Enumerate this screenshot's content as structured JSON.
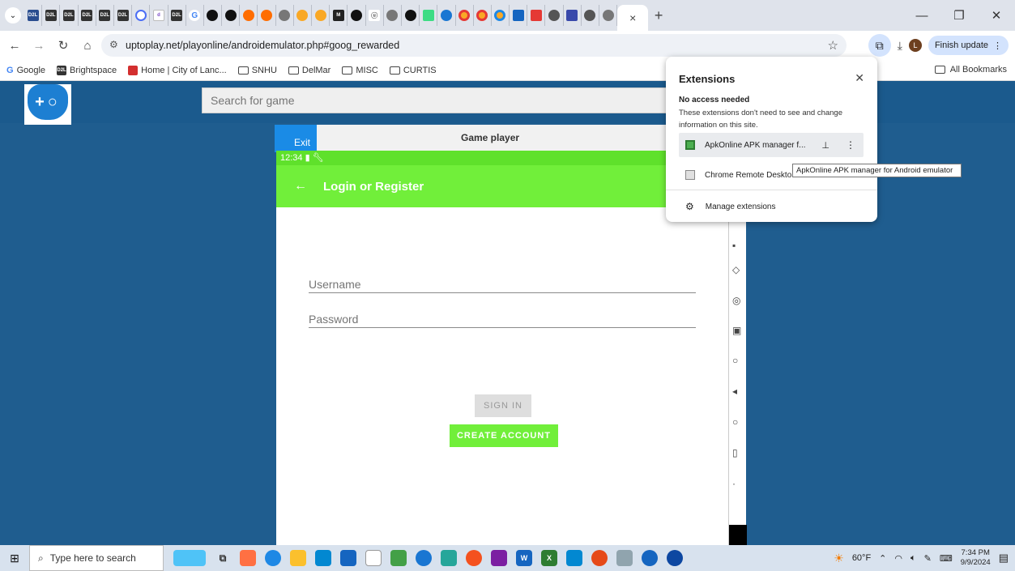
{
  "browser": {
    "active_tab_close": "×",
    "new_tab": "+",
    "minimize": "—",
    "maximize": "❐",
    "close": "✕",
    "url": "uptoplay.net/playonline/androidemulator.php#goog_rewarded",
    "finish_update_label": "Finish update",
    "avatar_letter": "L",
    "bookmarks": [
      {
        "label": "Google"
      },
      {
        "label": "Brightspace"
      },
      {
        "label": "Home | City of Lanc..."
      },
      {
        "label": "SNHU"
      },
      {
        "label": "DelMar"
      },
      {
        "label": "MISC"
      },
      {
        "label": "CURTIS"
      }
    ],
    "all_bookmarks_label": "All Bookmarks"
  },
  "site": {
    "search_placeholder": "Search for game",
    "player_title": "Game player",
    "exit_label": "Exit"
  },
  "android": {
    "time": "12:34",
    "appbar_title": "Login or Register",
    "username_placeholder": "Username",
    "password_placeholder": "Password",
    "signin_label": "SIGN IN",
    "create_label": "CREATE ACCOUNT"
  },
  "extensions": {
    "title": "Extensions",
    "section": "No access needed",
    "description": "These extensions don't need to see and change information on this site.",
    "items": [
      {
        "name": "ApkOnline APK manager f..."
      },
      {
        "name": "Chrome Remote Deskto"
      }
    ],
    "manage_label": "Manage extensions",
    "tooltip": "ApkOnline APK manager for Android emulator"
  },
  "taskbar": {
    "search_placeholder": "Type here to search",
    "weather": "60°F",
    "time": "7:34 PM",
    "date": "9/9/2024"
  },
  "colors": {
    "page_bg": "#1f5d8f",
    "android_green": "#71ef3a",
    "exit_blue": "#1a8be6"
  }
}
